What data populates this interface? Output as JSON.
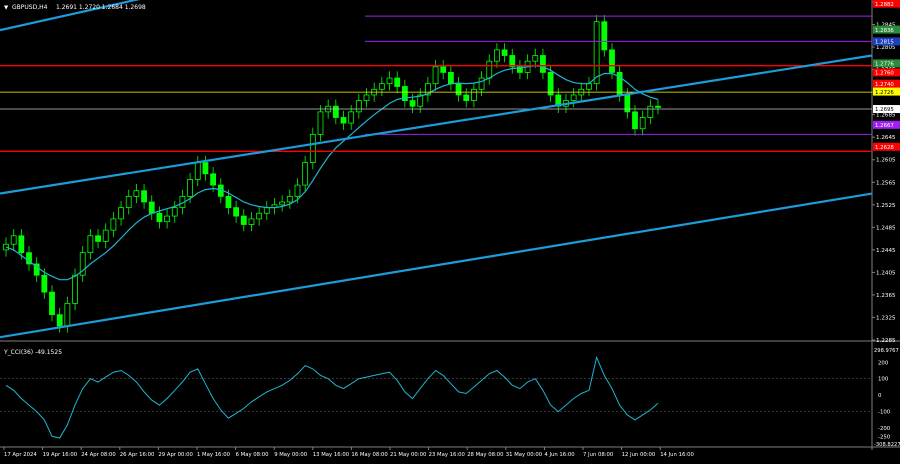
{
  "header": {
    "symbol_label": "GBPUSD,H4",
    "ohlc_label": "1.2691 1.2720 1.2684 1.2698"
  },
  "indicator": {
    "label": "Y_CCI(36) -49.1525",
    "axis_max_label": "298.9767",
    "axis_min_label": "-308.8227",
    "ticks": [
      {
        "value": 200,
        "label": "200"
      },
      {
        "value": 100,
        "label": "100"
      },
      {
        "value": 0,
        "label": "0"
      },
      {
        "value": -100,
        "label": "-100"
      },
      {
        "value": -200,
        "label": "-200"
      },
      {
        "value": -250,
        "label": "-250"
      }
    ]
  },
  "colors": {
    "background": "#000000",
    "candle": "#00ff00",
    "channel": "#1e9bd8",
    "ma": "#1fb6d2",
    "cci": "#1fb6d2",
    "support_resistance": "#ff0000",
    "murray": "#a020f0",
    "yellow_level": "#ffff00",
    "white_level": "#c8c8c8",
    "axis_text": "#ffffff"
  },
  "chart_data": {
    "type": "candlestick",
    "symbol": "GBPUSD",
    "timeframe": "H4",
    "ylim": [
      1.2285,
      1.2885
    ],
    "y_ticks": [
      "1.2885",
      "1.2845",
      "1.2805",
      "1.2765",
      "1.2725",
      "1.2685",
      "1.2645",
      "1.2605",
      "1.2565",
      "1.2525",
      "1.2485",
      "1.2445",
      "1.2405",
      "1.2365",
      "1.2325",
      "1.2285"
    ],
    "x_ticks": [
      "17 Apr 2024",
      "19 Apr 16:00",
      "24 Apr 08:00",
      "26 Apr 16:00",
      "29 Apr 00:00",
      "1 May 16:00",
      "6 May 08:00",
      "9 May 00:00",
      "13 May 16:00",
      "16 May 08:00",
      "21 May 00:00",
      "23 May 16:00",
      "28 May 08:00",
      "31 May 00:00",
      "4 Jun 16:00",
      "7 Jun 08:00",
      "12 Jun 00:00",
      "14 Jun 16:00"
    ],
    "close_series": [
      1.2455,
      1.247,
      1.244,
      1.242,
      1.24,
      1.237,
      1.233,
      1.231,
      1.235,
      1.24,
      1.244,
      1.247,
      1.246,
      1.248,
      1.25,
      1.252,
      1.254,
      1.255,
      1.253,
      1.251,
      1.2495,
      1.2505,
      1.252,
      1.254,
      1.257,
      1.26,
      1.258,
      1.256,
      1.254,
      1.252,
      1.2505,
      1.249,
      1.25,
      1.251,
      1.252,
      1.2525,
      1.253,
      1.254,
      1.256,
      1.26,
      1.265,
      1.269,
      1.27,
      1.268,
      1.267,
      1.269,
      1.271,
      1.272,
      1.273,
      1.274,
      1.275,
      1.2735,
      1.271,
      1.27,
      1.272,
      1.274,
      1.277,
      1.276,
      1.274,
      1.272,
      1.271,
      1.273,
      1.275,
      1.278,
      1.28,
      1.279,
      1.277,
      1.276,
      1.278,
      1.279,
      1.276,
      1.272,
      1.27,
      1.271,
      1.272,
      1.273,
      1.274,
      1.285,
      1.28,
      1.276,
      1.272,
      1.269,
      1.266,
      1.268,
      1.27,
      1.2698
    ],
    "ma_series": [
      1.245,
      1.2445,
      1.2435,
      1.2425,
      1.2415,
      1.2405,
      1.2398,
      1.2392,
      1.2392,
      1.2398,
      1.2408,
      1.242,
      1.243,
      1.244,
      1.2452,
      1.2466,
      1.248,
      1.2493,
      1.2503,
      1.251,
      1.2514,
      1.2518,
      1.2522,
      1.2528,
      1.2536,
      1.2546,
      1.2552,
      1.2554,
      1.2552,
      1.2546,
      1.2538,
      1.253,
      1.2525,
      1.2522,
      1.252,
      1.252,
      1.2522,
      1.2526,
      1.2534,
      1.2548,
      1.2568,
      1.259,
      1.261,
      1.2626,
      1.2638,
      1.265,
      1.2662,
      1.2674,
      1.2685,
      1.2695,
      1.2705,
      1.2712,
      1.2715,
      1.2716,
      1.2718,
      1.2722,
      1.273,
      1.2736,
      1.274,
      1.2741,
      1.274,
      1.2741,
      1.2744,
      1.275,
      1.2758,
      1.2764,
      1.2767,
      1.2768,
      1.277,
      1.2772,
      1.277,
      1.2764,
      1.2755,
      1.2747,
      1.2742,
      1.274,
      1.274,
      1.2752,
      1.2758,
      1.2758,
      1.2752,
      1.2742,
      1.273,
      1.2722,
      1.2716,
      1.2712
    ],
    "cci_series": [
      60,
      30,
      -20,
      -60,
      -100,
      -150,
      -250,
      -260,
      -180,
      -60,
      40,
      100,
      80,
      110,
      140,
      150,
      120,
      80,
      20,
      -30,
      -60,
      -20,
      30,
      80,
      140,
      160,
      70,
      -20,
      -90,
      -140,
      -110,
      -80,
      -40,
      -10,
      20,
      40,
      60,
      90,
      130,
      180,
      160,
      120,
      100,
      60,
      40,
      70,
      100,
      110,
      120,
      130,
      140,
      90,
      20,
      -20,
      40,
      100,
      150,
      120,
      70,
      20,
      10,
      50,
      90,
      130,
      150,
      110,
      60,
      40,
      80,
      100,
      30,
      -60,
      -100,
      -60,
      -20,
      10,
      30,
      230,
      120,
      40,
      -60,
      -120,
      -150,
      -120,
      -90,
      -49
    ]
  },
  "levels": {
    "red_lines": [
      1.2772,
      1.262
    ],
    "purple_lines": [
      1.286,
      1.2815,
      1.265
    ],
    "yellow_line": 1.2725,
    "white_line": 1.2695
  },
  "price_labels": [
    {
      "value": 1.2882,
      "text": "1.2882",
      "bg": "#ff0000",
      "fg": "#ffffff"
    },
    {
      "value": 1.2836,
      "text": "1.2836",
      "bg": "#2a8c3a",
      "fg": "#ffffff"
    },
    {
      "value": 1.2815,
      "text": "1.2815",
      "bg": "#1c3fbf",
      "fg": "#ffffff"
    },
    {
      "value": 1.2776,
      "text": "1.2776",
      "bg": "#2a8c3a",
      "fg": "#ffffff"
    },
    {
      "value": 1.276,
      "text": "1.2760",
      "bg": "#ff0000",
      "fg": "#ffffff"
    },
    {
      "value": 1.274,
      "text": "1.2740",
      "bg": "#ff0000",
      "fg": "#ffffff"
    },
    {
      "value": 1.2726,
      "text": "1.2726",
      "bg": "#ffff00",
      "fg": "#000000"
    },
    {
      "value": 1.2695,
      "text": "1.2695",
      "bg": "#ffffff",
      "fg": "#000000"
    },
    {
      "value": 1.2667,
      "text": "1.2667",
      "bg": "#a020f0",
      "fg": "#ffffff"
    },
    {
      "value": 1.2628,
      "text": "1.2628",
      "bg": "#ff0000",
      "fg": "#ffffff"
    }
  ],
  "channel_lines": [
    {
      "points": [
        [
          "17 Apr 2024",
          1.2835
        ],
        [
          "6 May 08:00",
          1.295
        ]
      ]
    },
    {
      "points": [
        [
          "17 Apr 2024",
          1.2545
        ],
        [
          "end",
          1.279
        ]
      ]
    },
    {
      "points": [
        [
          "17 Apr 2024",
          1.229
        ],
        [
          "end",
          1.2545
        ]
      ]
    }
  ]
}
